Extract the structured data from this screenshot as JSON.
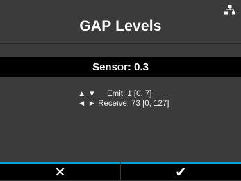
{
  "header": {
    "title": "GAP Levels",
    "status_icon": "network-icon"
  },
  "sensor": {
    "label": "Sensor: 0.3"
  },
  "adjustments": {
    "emit_keys": "▲ ▼",
    "emit_text": "Emit:  1  [0, 7]",
    "receive_keys": "◄ ►",
    "receive_text": "Receive: 73 [0, 127]"
  },
  "softkeys": {
    "cancel_glyph": "✕",
    "ok_glyph": "✔",
    "accent_color": "#00a0d8"
  }
}
